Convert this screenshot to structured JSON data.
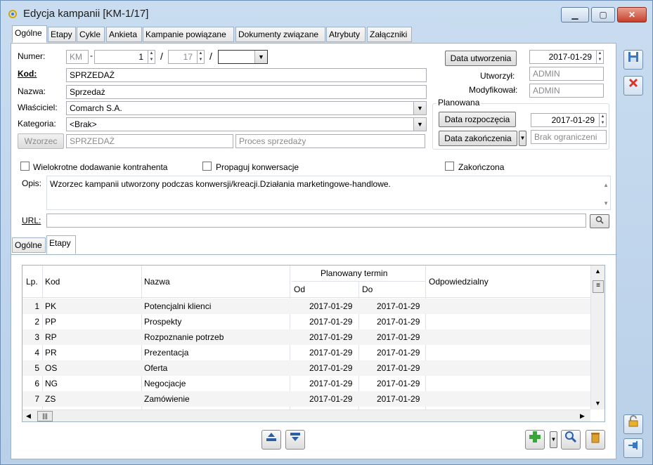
{
  "window": {
    "title": "Edycja kampanii [KM-1/17]",
    "minimize": "▁",
    "maximize": "▢",
    "close": "✕"
  },
  "tabs": [
    {
      "label": "Ogólne"
    },
    {
      "label": "Etapy"
    },
    {
      "label": "Cykle"
    },
    {
      "label": "Ankieta"
    },
    {
      "label": "Kampanie powiązane"
    },
    {
      "label": "Dokumenty związane"
    },
    {
      "label": "Atrybuty"
    },
    {
      "label": "Załączniki"
    }
  ],
  "form": {
    "numer_label": "Numer:",
    "numer_prefix": "KM",
    "numer_dash": "-",
    "numer_value": "1",
    "numer_slash1": "/",
    "numer_year": "17",
    "numer_slash2": "/",
    "numer_suffix": "",
    "kod_label": "Kod:",
    "kod_value": "SPRZEDAŻ",
    "nazwa_label": "Nazwa:",
    "nazwa_value": "Sprzedaż",
    "wlasciciel_label": "Właściciel:",
    "wlasciciel_value": "Comarch S.A.",
    "kategoria_label": "Kategoria:",
    "kategoria_value": "<Brak>",
    "wzorzec_button": "Wzorzec",
    "wzorzec_value": "SPRZEDAŻ",
    "proces_value": "Proces sprzedaży",
    "data_utworzenia_button": "Data utworzenia",
    "data_utworzenia_value": "2017-01-29",
    "utworzyl_label": "Utworzył:",
    "utworzyl_value": "ADMIN",
    "modyfikowal_label": "Modyfikował:",
    "modyfikowal_value": "ADMIN",
    "planowana_label": "Planowana",
    "data_rozpoczecia_button": "Data rozpoczęcia",
    "data_rozpoczecia_value": "2017-01-29",
    "data_zakonczenia_button": "Data zakończenia",
    "data_zakonczenia_value": "Brak ograniczeni",
    "wielokrotne_label": "Wielokrotne dodawanie kontrahenta",
    "propaguj_label": "Propaguj konwersacje",
    "zakonczona_label": "Zakończona",
    "opis_label": "Opis:",
    "opis_value": "Wzorzec kampanii utworzony podczas konwersji/kreacji.Działania marketingowe-handlowe.",
    "url_label": "URL:",
    "url_value": ""
  },
  "subtabs": [
    {
      "label": "Ogólne"
    },
    {
      "label": "Etapy"
    }
  ],
  "grid": {
    "headers": {
      "lp": "Lp.",
      "kod": "Kod",
      "nazwa": "Nazwa",
      "planowany": "Planowany termin",
      "od": "Od",
      "do": "Do",
      "odpowiedzialny": "Odpowiedzialny"
    },
    "rows": [
      {
        "lp": "1",
        "kod": "PK",
        "nazwa": "Potencjalni klienci",
        "od": "2017-01-29",
        "do": "2017-01-29",
        "odp": ""
      },
      {
        "lp": "2",
        "kod": "PP",
        "nazwa": "Prospekty",
        "od": "2017-01-29",
        "do": "2017-01-29",
        "odp": ""
      },
      {
        "lp": "3",
        "kod": "RP",
        "nazwa": "Rozpoznanie potrzeb",
        "od": "2017-01-29",
        "do": "2017-01-29",
        "odp": ""
      },
      {
        "lp": "4",
        "kod": "PR",
        "nazwa": "Prezentacja",
        "od": "2017-01-29",
        "do": "2017-01-29",
        "odp": ""
      },
      {
        "lp": "5",
        "kod": "OS",
        "nazwa": "Oferta",
        "od": "2017-01-29",
        "do": "2017-01-29",
        "odp": ""
      },
      {
        "lp": "6",
        "kod": "NG",
        "nazwa": "Negocjacje",
        "od": "2017-01-29",
        "do": "2017-01-29",
        "odp": ""
      },
      {
        "lp": "7",
        "kod": "ZS",
        "nazwa": "Zamówienie",
        "od": "2017-01-29",
        "do": "2017-01-29",
        "odp": ""
      }
    ]
  },
  "icons": {
    "save": "save-icon",
    "cancel": "cancel-icon",
    "add": "plus-icon",
    "search": "magnifier-icon",
    "delete": "trash-icon",
    "move_up": "move-up-icon",
    "move_down": "move-down-icon",
    "lock": "lock-icon",
    "pin": "pin-icon"
  },
  "colors": {
    "accent": "#3a78c2",
    "cancel_red": "#d9342b",
    "add_green": "#3aa53a"
  }
}
